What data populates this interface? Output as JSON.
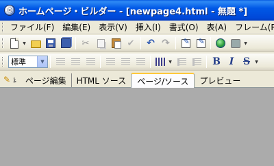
{
  "window": {
    "title": "ホームページ・ビルダー - [newpage4.html - 無題 *]"
  },
  "menu": [
    {
      "label": "ファイル(F)"
    },
    {
      "label": "編集(E)"
    },
    {
      "label": "表示(V)"
    },
    {
      "label": "挿入(I)"
    },
    {
      "label": "書式(O)"
    },
    {
      "label": "表(A)"
    },
    {
      "label": "フレーム(R)"
    }
  ],
  "toolbar2": {
    "paragraph_style": "標準"
  },
  "format": {
    "bold": "B",
    "italic": "I",
    "strike": "S"
  },
  "tabs": [
    {
      "label": "ページ編集"
    },
    {
      "label": "HTML ソース"
    },
    {
      "label": "ページ/ソース"
    },
    {
      "label": "プレビュー"
    }
  ],
  "active_tab": "ページ/ソース"
}
